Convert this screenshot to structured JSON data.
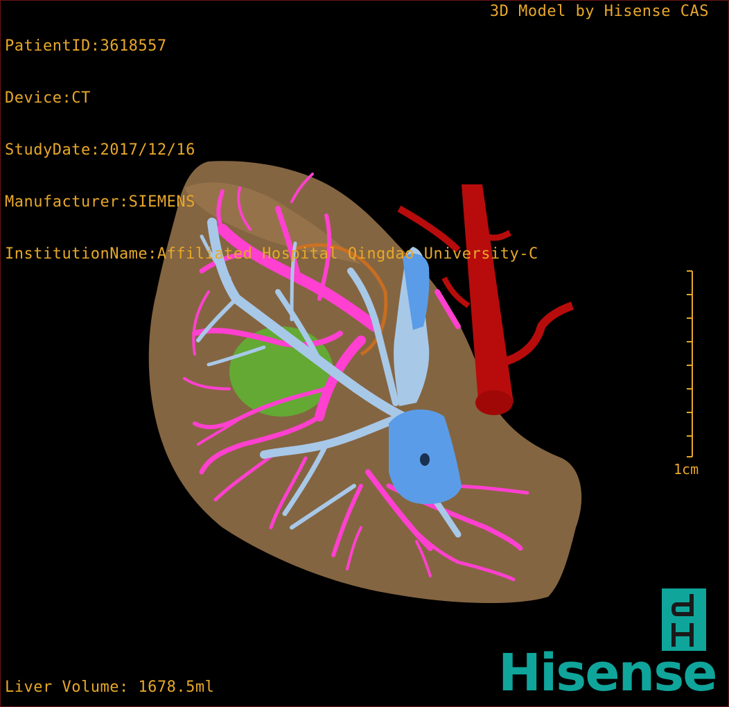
{
  "header": {
    "patient_id": "PatientID:3618557",
    "device": "Device:CT",
    "study_date": "StudyDate:2017/12/16",
    "manufacturer": "Manufacturer:SIEMENS",
    "institution": "InstitutionName:Affiliated Hospital Qingdao University-C"
  },
  "credit": "3D Model by Hisense CAS",
  "scale_bar": {
    "label": "1cm"
  },
  "footer": {
    "liver_volume": "Liver Volume: 1678.5ml"
  },
  "brand": {
    "logo_mark": "dH",
    "logo_text": "Hisense"
  },
  "colors": {
    "overlay_text": "#e8a82a",
    "liver": "#8b6a45",
    "portal_vein": "#ff40d0",
    "hepatic_vein": "#a8c8e8",
    "ivc": "#5b9ce8",
    "aorta": "#b80c0c",
    "lesion": "#58c030",
    "brand": "#0fa59b"
  }
}
